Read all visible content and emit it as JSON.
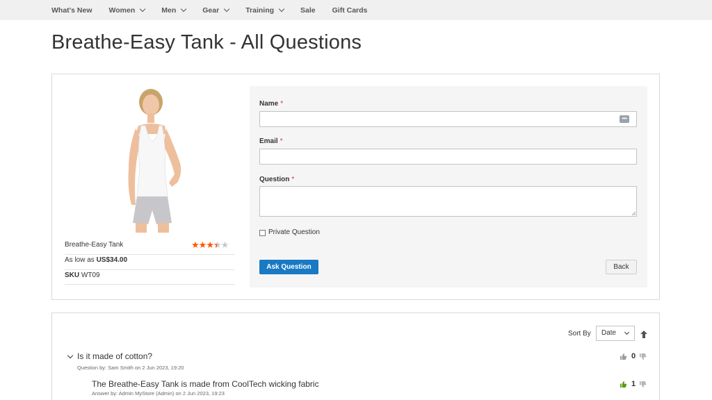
{
  "nav": {
    "items": [
      {
        "label": "What's New",
        "has_dropdown": false
      },
      {
        "label": "Women",
        "has_dropdown": true
      },
      {
        "label": "Men",
        "has_dropdown": true
      },
      {
        "label": "Gear",
        "has_dropdown": true
      },
      {
        "label": "Training",
        "has_dropdown": true
      },
      {
        "label": "Sale",
        "has_dropdown": false
      },
      {
        "label": "Gift Cards",
        "has_dropdown": false
      }
    ]
  },
  "page": {
    "title": "Breathe-Easy Tank - All Questions"
  },
  "product": {
    "name": "Breathe-Easy Tank",
    "rating": 3.5,
    "rating_max": 5,
    "price_prefix": "As low as",
    "price": "US$34.00",
    "sku_label": "SKU",
    "sku": "WT09"
  },
  "form": {
    "name_label": "Name",
    "email_label": "Email",
    "question_label": "Question",
    "required_mark": "*",
    "name_value": "",
    "email_value": "",
    "question_value": "",
    "private_label": "Private Question",
    "private_checked": false,
    "ask_label": "Ask Question",
    "back_label": "Back"
  },
  "questions": {
    "sort_label": "Sort By",
    "sort_value": "Date",
    "items": [
      {
        "question": "Is it made of cotton?",
        "question_meta": "Question by: Sam Smith on 2 Jun 2023, 19:20",
        "likes": "0",
        "answer": "The Breathe-Easy Tank is made from CoolTech wicking fabric",
        "answer_meta": "Answer by: Admin MyStore (Admin) on 2 Jun 2023, 19:23",
        "answer_likes": "1"
      }
    ]
  },
  "colors": {
    "primary_button": "#1979c3",
    "star_on": "#ff5501",
    "star_off": "#c7c7c7",
    "required": "#e02b27",
    "thumb_up_active": "#5a9a14",
    "thumb_neutral": "#9b9b9b"
  }
}
